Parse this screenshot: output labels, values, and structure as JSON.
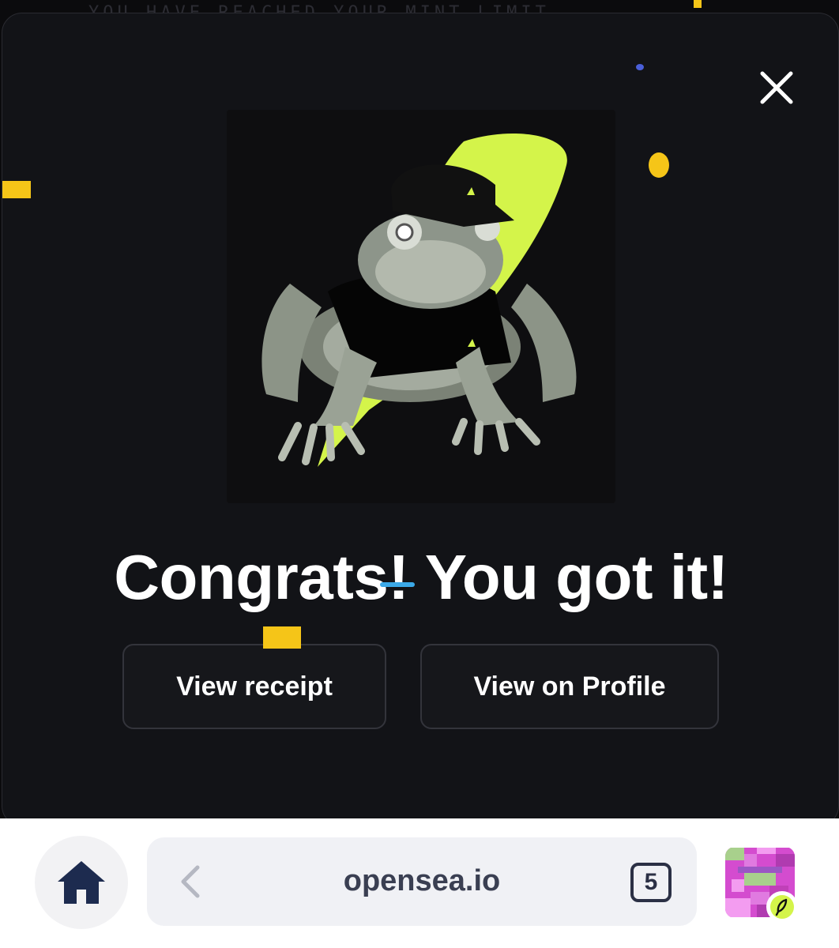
{
  "backdrop": {
    "partial_text": "YOU HAVE REACHED YOUR MINT LIMIT"
  },
  "modal": {
    "headline": "Congrats! You got it!",
    "buttons": {
      "view_receipt": "View receipt",
      "view_on_profile": "View on Profile"
    },
    "close_icon": "close-icon"
  },
  "browser": {
    "url": "opensea.io",
    "tab_count": "5",
    "home_icon": "home-icon",
    "back_icon": "chevron-left-icon"
  },
  "colors": {
    "accent_lime": "#D4F44A",
    "confetti_yellow": "#F5C518",
    "modal_bg": "#121317"
  }
}
